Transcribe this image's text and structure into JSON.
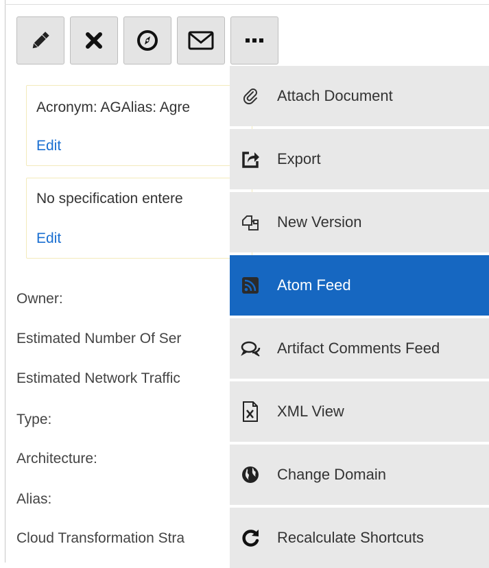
{
  "toolbar": {
    "buttons": [
      {
        "icon": "pencil-icon"
      },
      {
        "icon": "close-icon"
      },
      {
        "icon": "compass-icon"
      },
      {
        "icon": "envelope-icon"
      },
      {
        "icon": "more-icon"
      }
    ]
  },
  "cards": [
    {
      "text": "Acronym: AGAlias: Agre",
      "link": "Edit"
    },
    {
      "text": "No specification entere",
      "link": "Edit"
    }
  ],
  "fields": [
    "Owner:",
    "Estimated Number Of Ser",
    "Estimated Network Traffic",
    "Type:",
    "Architecture:",
    "Alias:",
    "Cloud Transformation Stra"
  ],
  "menu": {
    "items": [
      {
        "label": "Attach Document",
        "icon": "paperclip-icon",
        "active": false
      },
      {
        "label": "Export",
        "icon": "export-icon",
        "active": false
      },
      {
        "label": "New Version",
        "icon": "copy-icon",
        "active": false
      },
      {
        "label": "Atom Feed",
        "icon": "rss-icon",
        "active": true
      },
      {
        "label": "Artifact Comments Feed",
        "icon": "comments-icon",
        "active": false
      },
      {
        "label": "XML View",
        "icon": "xml-file-icon",
        "active": false
      },
      {
        "label": "Change Domain",
        "icon": "globe-icon",
        "active": false
      },
      {
        "label": "Recalculate Shortcuts",
        "icon": "refresh-icon",
        "active": false
      }
    ]
  },
  "colors": {
    "accent": "#1667c1",
    "link": "#1a6fd1",
    "menu_bg": "#e8e8e8",
    "button_bg": "#e4e4e4",
    "card_border": "#f3eaba"
  }
}
